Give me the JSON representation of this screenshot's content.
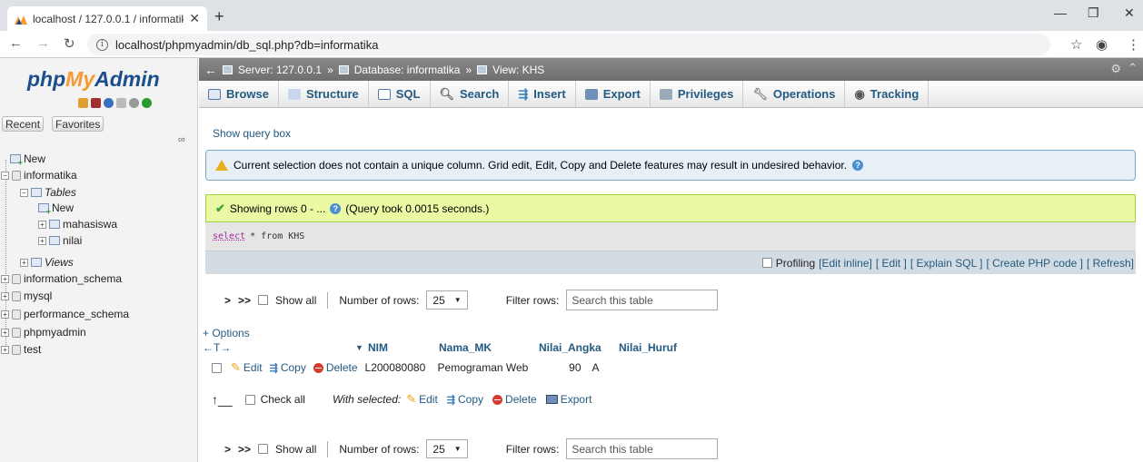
{
  "browser": {
    "tab_title": "localhost / 127.0.0.1 / informatika",
    "url": "localhost/phpmyadmin/db_sql.php?db=informatika"
  },
  "sidebar": {
    "logo_php": "php",
    "logo_my": "My",
    "logo_admin": "Admin",
    "tab_recent": "Recent",
    "tab_favorites": "Favorites",
    "tree": {
      "new": "New",
      "db_informatika": "informatika",
      "tables": "Tables",
      "tables_new": "New",
      "table_mahasiswa": "mahasiswa",
      "table_nilai": "nilai",
      "views": "Views",
      "db_information_schema": "information_schema",
      "db_mysql": "mysql",
      "db_performance_schema": "performance_schema",
      "db_phpmyadmin": "phpmyadmin",
      "db_test": "test"
    }
  },
  "breadcrumb": {
    "server": "Server: 127.0.0.1",
    "database": "Database: informatika",
    "view": "View: KHS"
  },
  "menu": {
    "browse": "Browse",
    "structure": "Structure",
    "sql": "SQL",
    "search": "Search",
    "insert": "Insert",
    "export": "Export",
    "privileges": "Privileges",
    "operations": "Operations",
    "tracking": "Tracking"
  },
  "show_query_box": "Show query box",
  "warning_text": "Current selection does not contain a unique column. Grid edit, Edit, Copy and Delete features may result in undesired behavior.",
  "success": {
    "showing": "Showing rows 0 - ...",
    "took": "(Query took 0.0015 seconds.)"
  },
  "sql": {
    "keyword": "select",
    "rest": "* from KHS"
  },
  "profiling": {
    "label": "Profiling",
    "edit_inline": "[Edit inline]",
    "edit": "[ Edit ]",
    "explain": "[ Explain SQL ]",
    "php": "[ Create PHP code ]",
    "refresh": "[ Refresh]"
  },
  "nav": {
    "next": ">",
    "last": ">>",
    "show_all": "Show all",
    "rows_label": "Number of rows:",
    "rows_value": "25",
    "filter_label": "Filter rows:",
    "filter_placeholder": "Search this table"
  },
  "options": "+ Options",
  "columns": {
    "arrows": "←T→",
    "nim": "NIM",
    "nama_mk": "Nama_MK",
    "nilai_angka": "Nilai_Angka",
    "nilai_huruf": "Nilai_Huruf"
  },
  "row": {
    "edit": "Edit",
    "copy": "Copy",
    "delete": "Delete",
    "nim": "L200080080",
    "nama_mk": "Pemograman Web",
    "nilai_angka": "90",
    "nilai_huruf": "A"
  },
  "bulk": {
    "check_all": "Check all",
    "with_selected": "With selected:",
    "edit": "Edit",
    "copy": "Copy",
    "delete": "Delete",
    "export": "Export"
  },
  "colors": {
    "link": "#235a81",
    "logo_blue": "#1b4e8c",
    "logo_orange": "#f79a2f",
    "success_bg": "#ebf8a4",
    "notice_bg": "#e7f0f7"
  }
}
